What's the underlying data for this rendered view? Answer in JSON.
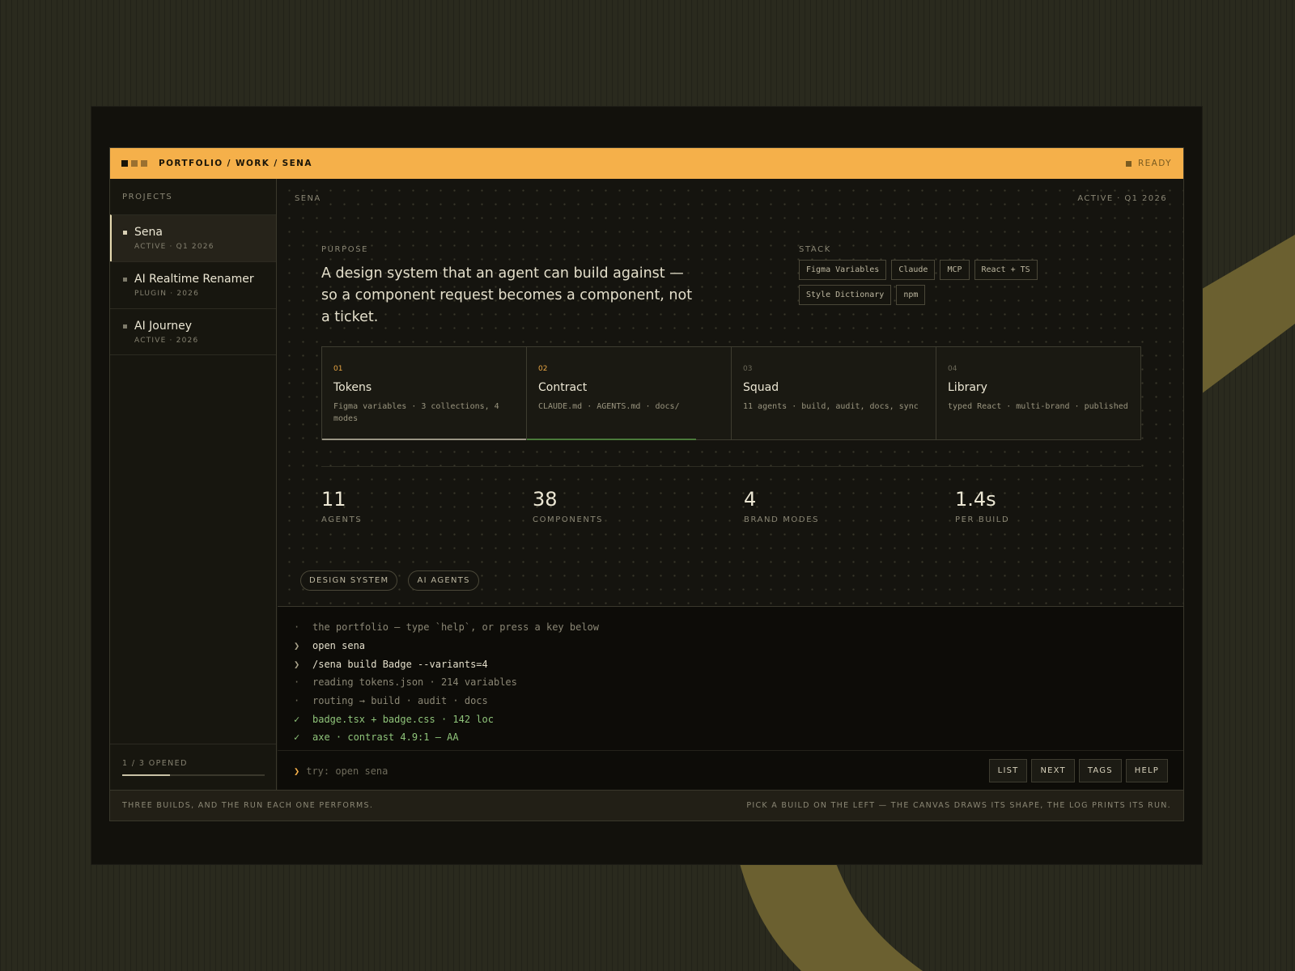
{
  "colors": {
    "accent": "#f5b04a",
    "background": "#2a2a1e",
    "panel": "#15140f",
    "success": "#8fc47a",
    "olive_decor": "#6b6030",
    "progress_bar": "#c9c2a6",
    "contract_bar": "#4a7a3a"
  },
  "topbar": {
    "breadcrumb": "PORTFOLIO / WORK / SENA",
    "status": "READY"
  },
  "sidebar": {
    "heading": "PROJECTS",
    "projects": [
      {
        "name": "Sena",
        "meta": "ACTIVE · Q1 2026",
        "active": true
      },
      {
        "name": "AI Realtime Renamer",
        "meta": "PLUGIN · 2026",
        "active": false
      },
      {
        "name": "AI Journey",
        "meta": "ACTIVE · 2026",
        "active": false
      }
    ],
    "progress_label": "1 / 3 OPENED",
    "progress_fraction": 0.333
  },
  "main": {
    "label_left": "SENA",
    "label_right": "ACTIVE · Q1 2026",
    "purpose_label": "PURPOSE",
    "purpose_text": "A design system that an agent can build against — so a component request becomes a component, not a ticket.",
    "stack_label": "STACK",
    "stack": [
      "Figma Variables",
      "Claude",
      "MCP",
      "React + TS",
      "Style Dictionary",
      "npm"
    ],
    "stages": [
      {
        "num": "01",
        "title": "Tokens",
        "desc": "Figma variables · 3 collections, 4 modes",
        "progress": 1.0
      },
      {
        "num": "02",
        "title": "Contract",
        "desc": "CLAUDE.md · AGENTS.md · docs/",
        "progress": 0.83
      },
      {
        "num": "03",
        "title": "Squad",
        "desc": "11 agents · build, audit, docs, sync",
        "progress": 0
      },
      {
        "num": "04",
        "title": "Library",
        "desc": "typed React · multi-brand · published",
        "progress": 0
      }
    ],
    "stats": [
      {
        "value": "11",
        "label": "AGENTS"
      },
      {
        "value": "38",
        "label": "COMPONENTS"
      },
      {
        "value": "4",
        "label": "BRAND MODES"
      },
      {
        "value": "1.4s",
        "label": "PER BUILD"
      }
    ],
    "tags": [
      "DESIGN SYSTEM",
      "AI AGENTS"
    ]
  },
  "console": {
    "lines": [
      {
        "prefix": "·",
        "text": "the portfolio — type `help`, or press a key below",
        "kind": "info"
      },
      {
        "prefix": "❯",
        "text": "open sena",
        "kind": "cmd"
      },
      {
        "prefix": "❯",
        "text": "/sena build Badge --variants=4",
        "kind": "cmd"
      },
      {
        "prefix": "·",
        "text": "reading tokens.json · 214 variables",
        "kind": "info"
      },
      {
        "prefix": "·",
        "text": "routing → build · audit · docs",
        "kind": "info"
      },
      {
        "prefix": "✓",
        "text": "badge.tsx + badge.css · 142 loc",
        "kind": "ok"
      },
      {
        "prefix": "✓",
        "text": "axe · contrast 4.9:1 — AA",
        "kind": "ok"
      }
    ],
    "prompt_caret": "❯",
    "input_placeholder": "try: open sena",
    "input_value": "",
    "buttons": [
      "LIST",
      "NEXT",
      "TAGS",
      "HELP"
    ]
  },
  "footer": {
    "left": "THREE BUILDS, AND THE RUN EACH ONE PERFORMS.",
    "right": "PICK A BUILD ON THE LEFT — THE CANVAS DRAWS ITS SHAPE, THE LOG PRINTS ITS RUN."
  }
}
